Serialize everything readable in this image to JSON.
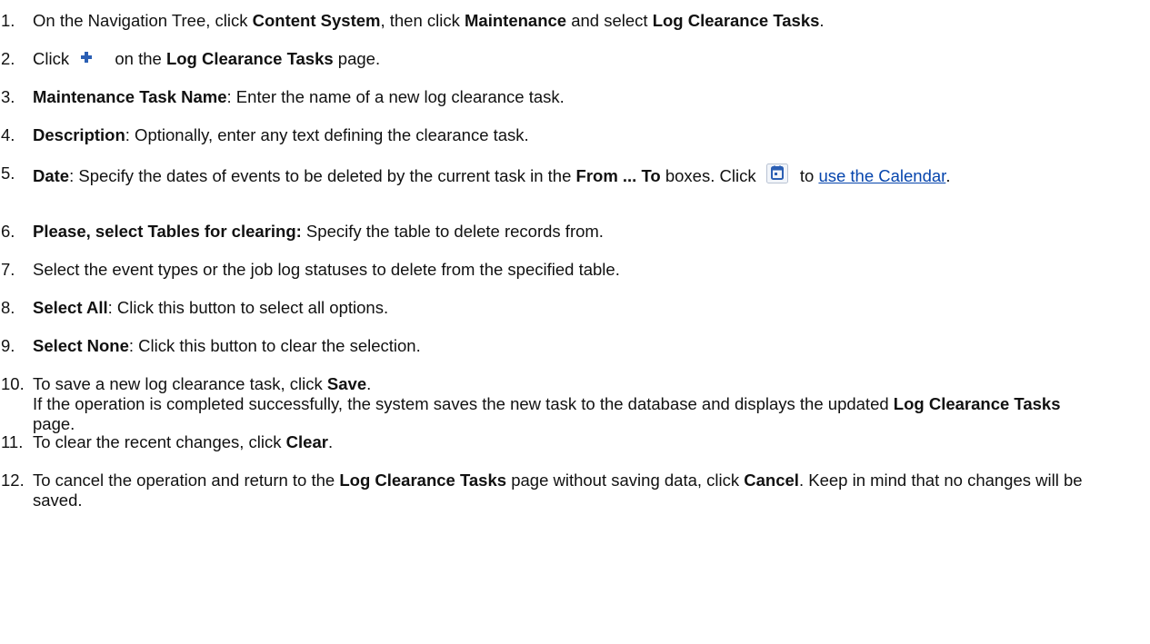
{
  "steps": [
    {
      "number": "1.",
      "parts": [
        {
          "t": "On the Navigation Tree, click "
        },
        {
          "t": "Content System",
          "b": true
        },
        {
          "t": ", then click "
        },
        {
          "t": "Maintenance",
          "b": true
        },
        {
          "t": " and select "
        },
        {
          "t": "Log Clearance Tasks",
          "b": true
        },
        {
          "t": "."
        }
      ]
    },
    {
      "number": "2.",
      "parts": [
        {
          "t": "Click "
        },
        {
          "icon": "plus-icon"
        },
        {
          "t": " on the "
        },
        {
          "t": "Log Clearance Tasks",
          "b": true
        },
        {
          "t": " page."
        }
      ]
    },
    {
      "number": "3.",
      "parts": [
        {
          "t": "Maintenance Task Name",
          "b": true
        },
        {
          "t": ": Enter the name of a new log clearance task."
        }
      ]
    },
    {
      "number": "4.",
      "parts": [
        {
          "t": "Description",
          "b": true
        },
        {
          "t": ": Optionally, enter any text defining the clearance task."
        }
      ]
    },
    {
      "number": "5.",
      "parts": [
        {
          "t": "Date",
          "b": true
        },
        {
          "t": ": Specify the dates of events to be deleted by the current task in the "
        },
        {
          "t": "From ... To",
          "b": true
        },
        {
          "t": " boxes. Click "
        },
        {
          "icon": "calendar-icon"
        },
        {
          "t": " to "
        },
        {
          "t": "use the Calendar",
          "link": true
        },
        {
          "t": "."
        }
      ]
    },
    {
      "number": "6.",
      "parts": [
        {
          "t": "Please, select Tables for clearing:",
          "b": true
        },
        {
          "t": " Specify the table to delete records from."
        }
      ]
    },
    {
      "number": "7.",
      "parts": [
        {
          "t": "Select the event types or the job log statuses to delete from the specified table."
        }
      ]
    },
    {
      "number": "8.",
      "parts": [
        {
          "t": "Select All",
          "b": true
        },
        {
          "t": ": Click this button to select all options."
        }
      ]
    },
    {
      "number": "9.",
      "parts": [
        {
          "t": "Select None",
          "b": true
        },
        {
          "t": ": Click this button to clear the selection."
        }
      ]
    },
    {
      "number": "10.",
      "parts": [
        {
          "t": "To save a new log clearance task, click "
        },
        {
          "t": "Save",
          "b": true
        },
        {
          "t": "."
        },
        {
          "br": true
        },
        {
          "t": "If the operation is completed successfully, the system saves the new task to the database and displays the updated "
        },
        {
          "t": "Log Clearance Tasks",
          "b": true
        },
        {
          "t": " page."
        }
      ]
    },
    {
      "number": "11.",
      "parts": [
        {
          "t": "To clear the recent changes, click "
        },
        {
          "t": "Clear",
          "b": true
        },
        {
          "t": "."
        }
      ]
    },
    {
      "number": "12.",
      "parts": [
        {
          "t": "To cancel the operation and return to the "
        },
        {
          "t": "Log Clearance Tasks",
          "b": true
        },
        {
          "t": " page without saving data, click "
        },
        {
          "t": "Cancel",
          "b": true
        },
        {
          "t": ". Keep in mind that no changes will be saved."
        }
      ]
    }
  ],
  "colors": {
    "text": "#111111",
    "link": "#0645ad",
    "plus_icon": "#2b5fb4",
    "calendar_icon": "#2b5fb4"
  }
}
